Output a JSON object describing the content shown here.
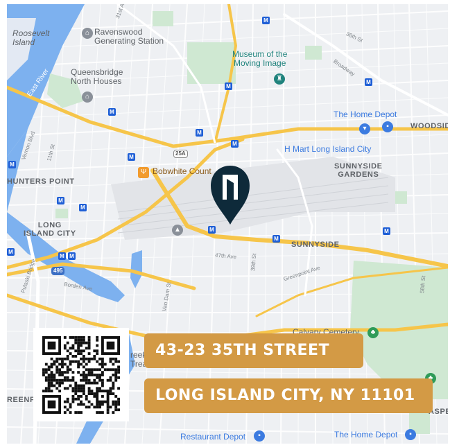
{
  "map": {
    "labels": {
      "roosevelt_island": "Roosevelt\nIsland",
      "east_river": "East River",
      "ravenswood": "Ravenswood\nGenerating Station",
      "queensbridge": "Queensbridge\nNorth Houses",
      "museum": "Museum of the\nMoving Image",
      "home_depot_1": "The Home Depot",
      "home_depot_2": "The Home Depot",
      "woodside": "WOODSID",
      "hmart": "H Mart Long Island City",
      "sunnyside_gardens": "SUNNYSIDE\nGARDENS",
      "bobwhite": "Bobwhite Count",
      "hunters_point": "HUNTERS POINT",
      "long_island_city": "LONG\nISLAND CITY",
      "sunnyside": "SUNNYSIDE",
      "greenpoint_partial": "REENP",
      "aspet_partial": "ASPET",
      "restaurant_depot": "Restaurant Depot",
      "calvary": "Calvary Cemetery",
      "creek": "reek\nTrea"
    },
    "streets": {
      "st_36": "36th St",
      "ave_31": "31st Ave",
      "broadway": "Broadway",
      "vernon": "Vernon Blvd",
      "st_11": "11th St",
      "ave_47": "47th Ave",
      "st_39": "39th St",
      "greenpoint_ave": "Greenpoint Ave",
      "borden": "Borden Ave",
      "van_dam": "Van Dam St",
      "pulaski": "Pulaski Bridge",
      "st_58": "58th St"
    },
    "shields": {
      "route_25a": "25A",
      "route_495": "495"
    },
    "transit_symbol": "M",
    "pin_name": "location-pin"
  },
  "overlay": {
    "address_line_1": "43-23 35TH STREET",
    "address_line_2": "LONG ISLAND CITY, NY 11101"
  },
  "colors": {
    "banner": "#d39a45",
    "pin": "#0e2a3a",
    "water": "#7db1ef",
    "park": "#cfe8d2",
    "highway": "#f6c54a",
    "transit": "#1f5fd6"
  }
}
